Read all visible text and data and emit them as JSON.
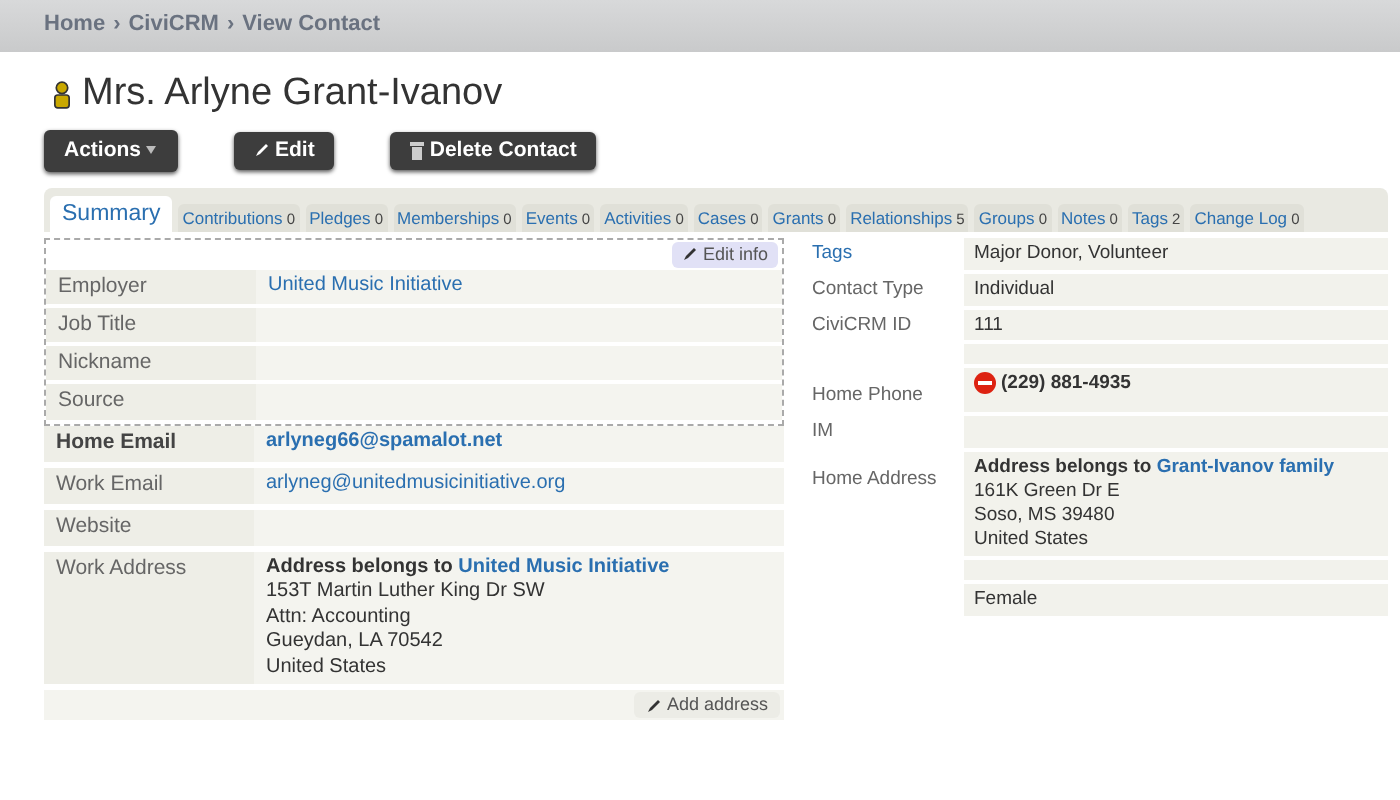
{
  "breadcrumb": {
    "separator": "›",
    "items": [
      "Home",
      "CiviCRM",
      "View Contact"
    ]
  },
  "contact": {
    "name": "Mrs. Arlyne Grant-Ivanov"
  },
  "actions": [
    {
      "label": "Actions",
      "kind": "menu"
    },
    {
      "label": "Edit",
      "kind": "edit"
    },
    {
      "label": "Delete Contact",
      "kind": "delete"
    }
  ],
  "tabs": [
    {
      "label": "Summary",
      "selected": true
    },
    {
      "label": "Contributions",
      "count": "0",
      "selected": false
    },
    {
      "label": "Pledges",
      "count": "0",
      "selected": false
    },
    {
      "label": "Memberships",
      "count": "0",
      "selected": false
    },
    {
      "label": "Events",
      "count": "0",
      "selected": false
    },
    {
      "label": "Activities",
      "count": "0",
      "selected": false
    },
    {
      "label": "Cases",
      "count": "0",
      "selected": false
    },
    {
      "label": "Grants",
      "count": "0",
      "selected": false
    },
    {
      "label": "Relationships",
      "count": "5",
      "selected": false
    },
    {
      "label": "Groups",
      "count": "0",
      "selected": false
    },
    {
      "label": "Notes",
      "count": "0",
      "selected": false
    },
    {
      "label": "Tags",
      "count": "2",
      "selected": false
    },
    {
      "label": "Change Log",
      "count": "0",
      "selected": false
    }
  ],
  "info_block": {
    "edit_label": "Edit info",
    "fields": [
      {
        "label": "Employer",
        "value": "United Music Initiative",
        "kind": "link"
      },
      {
        "label": "Job Title"
      },
      {
        "label": "Nickname"
      },
      {
        "label": "Source"
      }
    ]
  },
  "contact_fields": [
    {
      "label": "Home Email",
      "value": "arlyneg66@spamalot.net",
      "kind": "link",
      "primary": true
    },
    {
      "label": "Work Email",
      "value": "arlyneg@unitedmusicinitiative.org",
      "kind": "link",
      "primary": false
    },
    {
      "label": "Website"
    },
    {
      "label": "Work Address",
      "kind": "address",
      "owner_prefix": "Address belongs to",
      "owner": "United Music Initiative",
      "lines": [
        "153T Martin Luther King Dr SW",
        "Attn: Accounting",
        "Gueydan, LA 70542",
        "United States"
      ]
    }
  ],
  "add_address_label": "Add address",
  "side_fields": [
    {
      "label": "Tags",
      "label_link": true,
      "value": "Major Donor, Volunteer"
    },
    {
      "label": "Contact Type",
      "value": "Individual"
    },
    {
      "label": "CiviCRM ID",
      "value": "111"
    },
    {
      "kind": "spacer"
    },
    {
      "label": "Home Phone",
      "value": "(229) 881-4935",
      "kind": "phone",
      "primary": true,
      "do_not_contact": true
    },
    {
      "label": "IM"
    },
    {
      "label": "Home Address",
      "kind": "address",
      "owner_prefix": "Address belongs to",
      "owner": "Grant-Ivanov family",
      "lines": [
        "161K Green Dr E",
        "Soso, MS 39480",
        "United States"
      ]
    },
    {
      "kind": "spacer"
    },
    {
      "value": "Female"
    }
  ]
}
